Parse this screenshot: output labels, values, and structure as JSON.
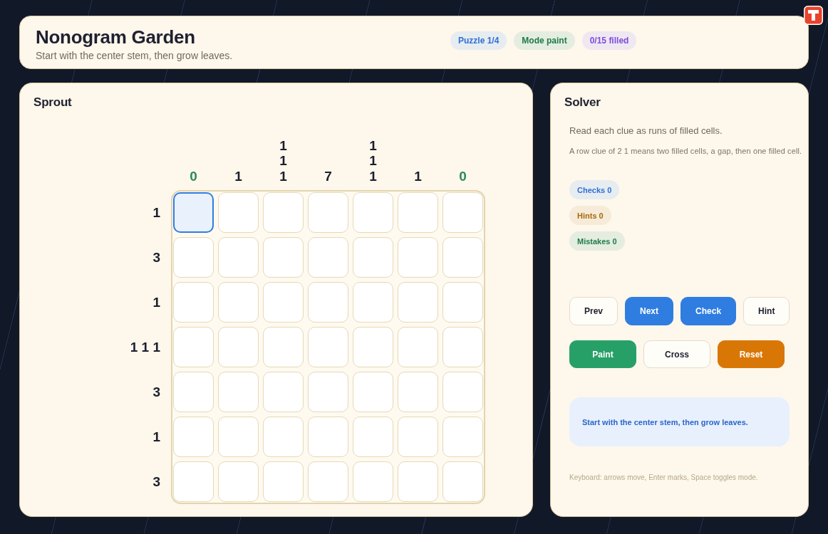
{
  "header": {
    "title": "Nonogram Garden",
    "subtitle": "Start with the center stem, then grow leaves.",
    "badges": [
      {
        "label": "Puzzle 1/4",
        "color": "#2f6fd6"
      },
      {
        "label": "Mode paint",
        "color": "#1f7a4b"
      },
      {
        "label": "0/15 filled",
        "color": "#7c4ddb"
      }
    ]
  },
  "board": {
    "title": "Sprout",
    "column_clues": [
      {
        "numbers": [
          "0"
        ],
        "done": true
      },
      {
        "numbers": [
          "1"
        ],
        "done": false
      },
      {
        "numbers": [
          "1",
          "1",
          "1"
        ],
        "done": false
      },
      {
        "numbers": [
          "7"
        ],
        "done": false
      },
      {
        "numbers": [
          "1",
          "1",
          "1"
        ],
        "done": false
      },
      {
        "numbers": [
          "1"
        ],
        "done": false
      },
      {
        "numbers": [
          "0"
        ],
        "done": true
      }
    ],
    "row_clues": [
      {
        "text": "1",
        "done": false
      },
      {
        "text": "3",
        "done": false
      },
      {
        "text": "1",
        "done": false
      },
      {
        "text": "1 1 1",
        "done": false
      },
      {
        "text": "3",
        "done": false
      },
      {
        "text": "1",
        "done": false
      },
      {
        "text": "3",
        "done": false
      }
    ],
    "rows": [
      {
        "cells": [
          {
            "selected": true
          },
          {
            "selected": false
          },
          {
            "selected": false
          },
          {
            "selected": false
          },
          {
            "selected": false
          },
          {
            "selected": false
          },
          {
            "selected": false
          }
        ]
      },
      {
        "cells": [
          {
            "selected": false
          },
          {
            "selected": false
          },
          {
            "selected": false
          },
          {
            "selected": false
          },
          {
            "selected": false
          },
          {
            "selected": false
          },
          {
            "selected": false
          }
        ]
      },
      {
        "cells": [
          {
            "selected": false
          },
          {
            "selected": false
          },
          {
            "selected": false
          },
          {
            "selected": false
          },
          {
            "selected": false
          },
          {
            "selected": false
          },
          {
            "selected": false
          }
        ]
      },
      {
        "cells": [
          {
            "selected": false
          },
          {
            "selected": false
          },
          {
            "selected": false
          },
          {
            "selected": false
          },
          {
            "selected": false
          },
          {
            "selected": false
          },
          {
            "selected": false
          }
        ]
      },
      {
        "cells": [
          {
            "selected": false
          },
          {
            "selected": false
          },
          {
            "selected": false
          },
          {
            "selected": false
          },
          {
            "selected": false
          },
          {
            "selected": false
          },
          {
            "selected": false
          }
        ]
      },
      {
        "cells": [
          {
            "selected": false
          },
          {
            "selected": false
          },
          {
            "selected": false
          },
          {
            "selected": false
          },
          {
            "selected": false
          },
          {
            "selected": false
          },
          {
            "selected": false
          }
        ]
      },
      {
        "cells": [
          {
            "selected": false
          },
          {
            "selected": false
          },
          {
            "selected": false
          },
          {
            "selected": false
          },
          {
            "selected": false
          },
          {
            "selected": false
          },
          {
            "selected": false
          }
        ]
      }
    ]
  },
  "solver": {
    "title": "Solver",
    "intro": "Read each clue as runs of filled cells.",
    "explanation": "A row clue of 2 1 means two filled cells, a gap, then one filled cell.",
    "stats": [
      {
        "label": "Checks 0",
        "color": "#2f6fd6"
      },
      {
        "label": "Hints 0",
        "color": "#a8680c"
      },
      {
        "label": "Mistakes 0",
        "color": "#1f7a4b"
      }
    ],
    "actions": [
      {
        "label": "Prev",
        "kind": "outline"
      },
      {
        "label": "Next",
        "kind": "primary"
      },
      {
        "label": "Check",
        "kind": "primary"
      },
      {
        "label": "Hint",
        "kind": "outline"
      }
    ],
    "modes": [
      {
        "label": "Paint",
        "selected": true
      },
      {
        "label": "Cross",
        "selected": false
      }
    ],
    "reset": {
      "label": "Reset"
    },
    "message": "Start with the center stem, then grow leaves.",
    "keyboard_hint": "Keyboard: arrows move, Enter marks, Space toggles mode."
  }
}
